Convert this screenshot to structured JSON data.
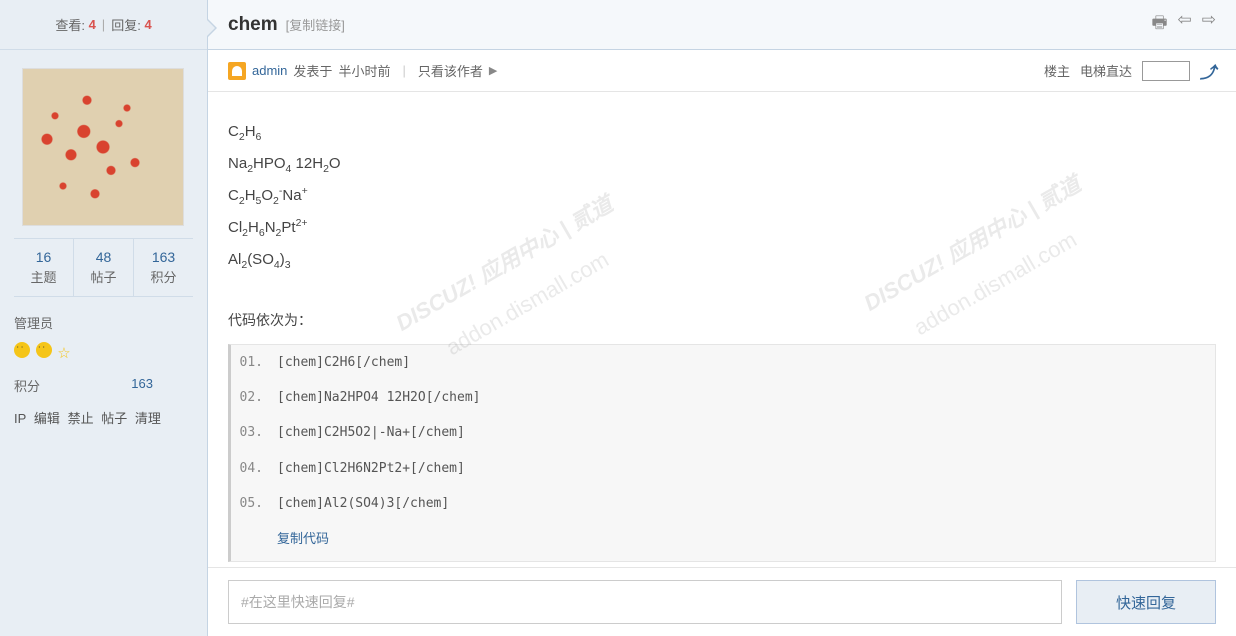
{
  "sidebar": {
    "views_label": "查看:",
    "views": "4",
    "replies_label": "回复:",
    "replies": "4",
    "stats": [
      {
        "val": "16",
        "lbl": "主题"
      },
      {
        "val": "48",
        "lbl": "帖子"
      },
      {
        "val": "163",
        "lbl": "积分"
      }
    ],
    "role": "管理员",
    "score_label": "积分",
    "score_value": "163",
    "admin_links": [
      "IP",
      "编辑",
      "禁止",
      "帖子",
      "清理"
    ]
  },
  "header": {
    "title": "chem",
    "copy_link": "[复制链接]"
  },
  "meta": {
    "username": "admin",
    "posted_prefix": "发表于",
    "posted_time": "半小时前",
    "only_author": "只看该作者",
    "floor_owner": "楼主",
    "elevator": "电梯直达"
  },
  "content": {
    "formulas_html": [
      "C<sub>2</sub>H<sub>6</sub>",
      "Na<sub>2</sub>HPO<sub>4</sub> 12H<sub>2</sub>O",
      "C<sub>2</sub>H<sub>5</sub>O<sub>2</sub><sup>-</sup>Na<sup>+</sup>",
      "Cl<sub>2</sub>H<sub>6</sub>N<sub>2</sub>Pt<sup>2+</sup>",
      "Al<sub>2</sub>(SO<sub>4</sub>)<sub>3</sub>"
    ],
    "code_label": "代码依次为：",
    "code_lines": [
      "[chem]C2H6[/chem]",
      "[chem]Na2HPO4 12H2O[/chem]",
      "[chem]C2H5O2|-Na+[/chem]",
      "[chem]Cl2H6N2Pt2+[/chem]",
      "[chem]Al2(SO4)3[/chem]"
    ],
    "copy_code": "复制代码"
  },
  "reply": {
    "placeholder": "#在这里快速回复#",
    "button": "快速回复"
  },
  "watermark": {
    "line1": "DISCUZ! 应用中心 | 贰道",
    "line2": "addon.dismall.com"
  }
}
